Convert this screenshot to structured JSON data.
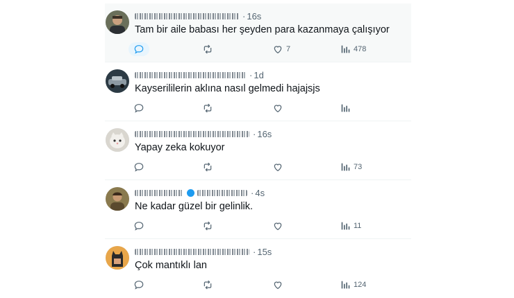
{
  "replies": [
    {
      "time": "16s",
      "text": "Tam bir aile babası her şeyden para kazanmaya çalışıyor",
      "likes": "7",
      "views": "478",
      "hovered": true,
      "avatar": "avatar-man-dark"
    },
    {
      "time": "1d",
      "text": "Kayserililerin aklına nasıl gelmedi hajajsjs",
      "likes": "",
      "views": "",
      "hovered": false,
      "avatar": "avatar-car"
    },
    {
      "time": "16s",
      "text": "Yapay zeka kokuyor",
      "likes": "",
      "views": "73",
      "hovered": false,
      "avatar": "avatar-cat"
    },
    {
      "time": "4s",
      "text": "Ne kadar güzel bir gelinlik.",
      "likes": "",
      "views": "11",
      "hovered": false,
      "avatar": "avatar-person-outdoor",
      "verified": true
    },
    {
      "time": "15s",
      "text": "Çok mantıklı lan",
      "likes": "",
      "views": "124",
      "hovered": false,
      "avatar": "avatar-batman"
    }
  ],
  "icons": {
    "reply": "speech-bubble-icon",
    "retweet": "retweet-icon",
    "like": "heart-icon",
    "views": "bar-chart-icon"
  },
  "colors": {
    "accent": "#1d9bf0",
    "muted": "#536471",
    "text": "#0f1419"
  }
}
